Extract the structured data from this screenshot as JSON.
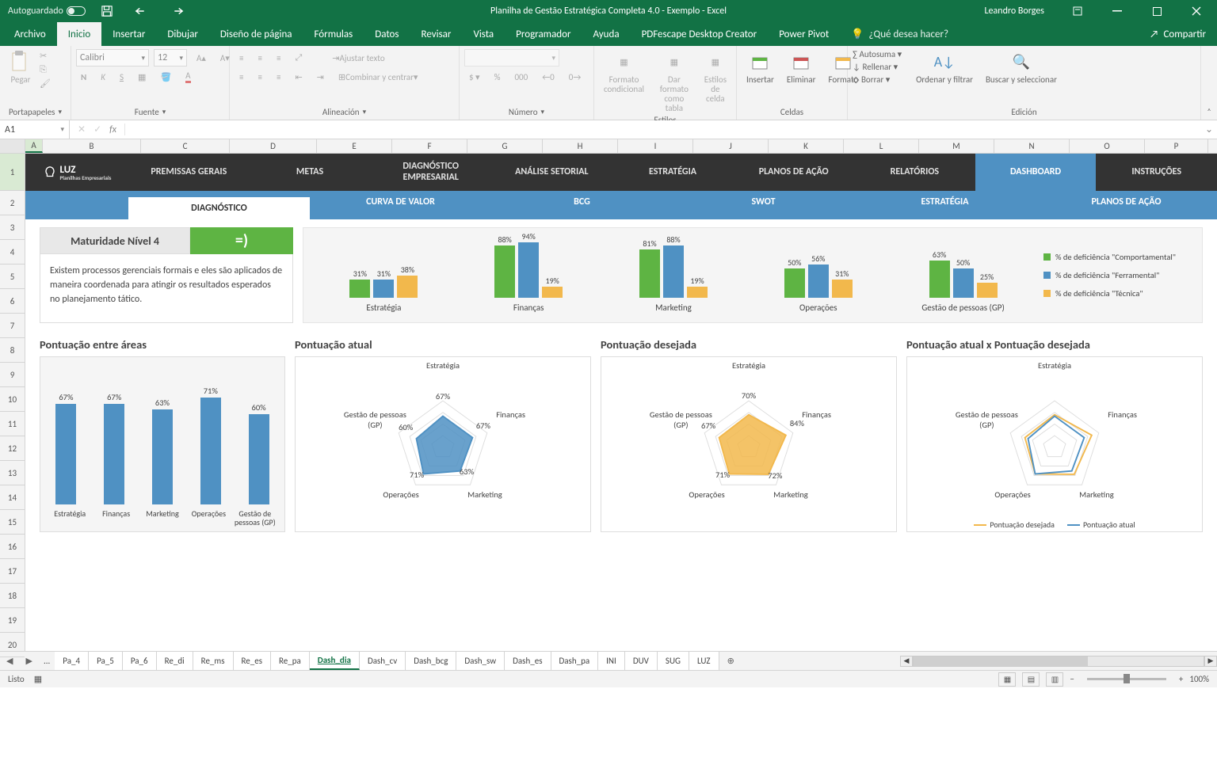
{
  "titlebar": {
    "autosave": "Autoguardado",
    "title": "Planilha de Gestão Estratégica Completa 4.0 - Exemplo - Excel",
    "user": "Leandro Borges"
  },
  "menubar": {
    "tabs": [
      "Archivo",
      "Inicio",
      "Insertar",
      "Dibujar",
      "Diseño de página",
      "Fórmulas",
      "Datos",
      "Revisar",
      "Vista",
      "Programador",
      "Ayuda",
      "PDFescape Desktop Creator",
      "Power Pivot"
    ],
    "active": 1,
    "tell": "¿Qué desea hacer?",
    "share": "Compartir"
  },
  "ribbon": {
    "groups": {
      "portapapeles": "Portapapeles",
      "pegar": "Pegar",
      "fuente": "Fuente",
      "fontname": "Calibri",
      "fontsize": "12",
      "alineacion": "Alineación",
      "ajustar": "Ajustar texto",
      "combinar": "Combinar y centrar",
      "numero": "Número",
      "estilos": "Estilos",
      "fmt_cond": "Formato condicional",
      "fmt_tabla": "Dar formato como tabla",
      "est_celda": "Estilos de celda",
      "celdas": "Celdas",
      "insertar": "Insertar",
      "eliminar": "Eliminar",
      "formato": "Formato",
      "edicion": "Edición",
      "autosuma": "Autosuma",
      "rellenar": "Rellenar",
      "borrar": "Borrar",
      "ordenar": "Ordenar y filtrar",
      "buscar": "Buscar y seleccionar"
    }
  },
  "formulabar": {
    "cell": "A1"
  },
  "columns": [
    "A",
    "B",
    "C",
    "D",
    "E",
    "F",
    "G",
    "H",
    "I",
    "J",
    "K",
    "L",
    "M",
    "N",
    "O",
    "P"
  ],
  "rows_count": 20,
  "dashnav": {
    "logo": "LUZ",
    "logo_sub": "Planilhas Empresariais",
    "tabs": [
      "PREMISSAS GERAIS",
      "METAS",
      "DIAGNÓSTICO EMPRESARIAL",
      "ANÁLISE SETORIAL",
      "ESTRATÉGIA",
      "PLANOS DE AÇÃO",
      "RELATÓRIOS",
      "DASHBOARD",
      "INSTRUÇÕES"
    ],
    "active": 7
  },
  "subnav": {
    "tabs": [
      "DIAGNÓSTICO",
      "CURVA DE VALOR",
      "BCG",
      "SWOT",
      "ESTRATÉGIA",
      "PLANOS DE AÇÃO"
    ],
    "active": 0
  },
  "maturity": {
    "title": "Maturidade Nível 4",
    "face": "=)",
    "body": "Existem processos gerenciais formais e eles são aplicados de maneira coordenada para atingir os resultados esperados no planejamento tático."
  },
  "chart_data": [
    {
      "name": "deficiencias",
      "type": "bar",
      "title": "",
      "categories": [
        "Estratégia",
        "Finanças",
        "Marketing",
        "Operações",
        "Gestão de pessoas (GP)"
      ],
      "series": [
        {
          "name": "% de deficiência \"Comportamental\"",
          "values": [
            31,
            88,
            81,
            50,
            63
          ],
          "color": "#5eb443"
        },
        {
          "name": "% de deficiência \"Ferramental\"",
          "values": [
            31,
            94,
            88,
            56,
            50
          ],
          "color": "#4f91c3"
        },
        {
          "name": "% de deficiência \"Técnica\"",
          "values": [
            38,
            19,
            19,
            31,
            25
          ],
          "color": "#f2b84c"
        }
      ],
      "ylim": [
        0,
        100
      ]
    },
    {
      "name": "pontuacao_areas",
      "type": "bar",
      "title": "Pontuação entre áreas",
      "categories": [
        "Estratégia",
        "Finanças",
        "Marketing",
        "Operações",
        "Gestão de pessoas (GP)"
      ],
      "values": [
        67,
        67,
        63,
        71,
        60
      ],
      "color": "#4f91c3",
      "ylim": [
        0,
        100
      ]
    },
    {
      "name": "pontuacao_atual",
      "type": "radar",
      "title": "Pontuação atual",
      "categories": [
        "Estratégia",
        "Finanças",
        "Marketing",
        "Operações",
        "Gestão de pessoas (GP)"
      ],
      "values": [
        67,
        67,
        63,
        71,
        60
      ],
      "color": "#4f91c3"
    },
    {
      "name": "pontuacao_desejada",
      "type": "radar",
      "title": "Pontuação desejada",
      "categories": [
        "Estratégia",
        "Finanças",
        "Marketing",
        "Operações",
        "Gestão de pessoas (GP)"
      ],
      "values": [
        70,
        84,
        72,
        71,
        67
      ],
      "color": "#f2b84c"
    },
    {
      "name": "atual_vs_desejada",
      "type": "radar",
      "title": "Pontuação atual x Pontuação desejada",
      "categories": [
        "Estratégia",
        "Finanças",
        "Marketing",
        "Operações",
        "Gestão de pessoas (GP)"
      ],
      "series": [
        {
          "name": "Pontuação desejada",
          "values": [
            70,
            84,
            72,
            71,
            67
          ],
          "color": "#f2b84c"
        },
        {
          "name": "Pontuação atual",
          "values": [
            67,
            67,
            63,
            71,
            60
          ],
          "color": "#4f91c3"
        }
      ],
      "legend": [
        "Pontuação desejada",
        "Pontuação atual"
      ]
    }
  ],
  "chart_titles": {
    "areas": "Pontuação entre áreas",
    "atual": "Pontuação atual",
    "desejada": "Pontuação desejada",
    "both": "Pontuação atual x Pontuação desejada"
  },
  "sheet_tabs": [
    "Pa_4",
    "Pa_5",
    "Pa_6",
    "Re_di",
    "Re_ms",
    "Re_es",
    "Re_pa",
    "Dash_dia",
    "Dash_cv",
    "Dash_bcg",
    "Dash_sw",
    "Dash_es",
    "Dash_pa",
    "INI",
    "DUV",
    "SUG",
    "LUZ"
  ],
  "sheet_active": 7,
  "statusbar": {
    "ready": "Listo",
    "zoom": "100%"
  }
}
